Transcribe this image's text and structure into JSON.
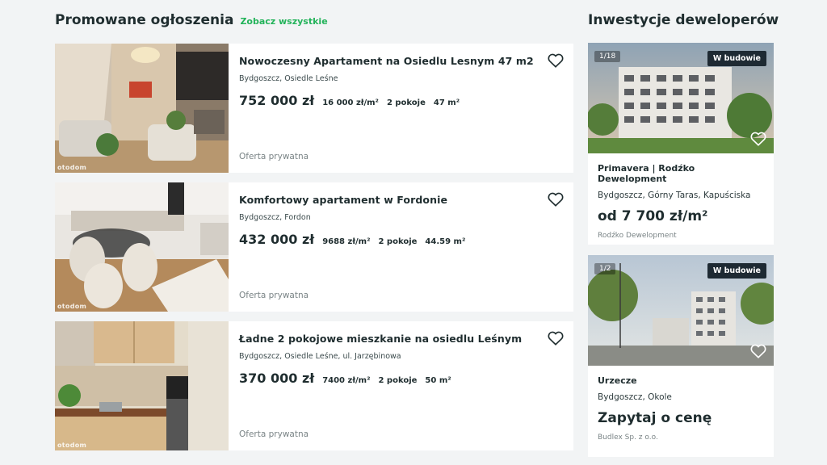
{
  "promoted": {
    "title": "Promowane ogłoszenia",
    "see_all": "Zobacz wszystkie",
    "listings": [
      {
        "title": "Nowoczesny Apartament na Osiedlu Lesnym 47 m2",
        "location": "Bydgoszcz, Osiedle Leśne",
        "price": "752 000 zł",
        "price_per_m2": "16 000 zł/m²",
        "rooms": "2 pokoje",
        "area": "47 m²",
        "owner": "Oferta prywatna",
        "watermark": "otodom"
      },
      {
        "title": "Komfortowy apartament w Fordonie",
        "location": "Bydgoszcz, Fordon",
        "price": "432 000 zł",
        "price_per_m2": "9688 zł/m²",
        "rooms": "2 pokoje",
        "area": "44.59 m²",
        "owner": "Oferta prywatna",
        "watermark": "otodom"
      },
      {
        "title": "Ładne 2 pokojowe mieszkanie na osiedlu Leśnym",
        "location": "Bydgoszcz, Osiedle Leśne, ul. Jarzębinowa",
        "price": "370 000 zł",
        "price_per_m2": "7400 zł/m²",
        "rooms": "2 pokoje",
        "area": "50 m²",
        "owner": "Oferta prywatna",
        "watermark": "otodom"
      }
    ]
  },
  "developer": {
    "title": "Inwestycje deweloperów",
    "cards": [
      {
        "counter": "1/18",
        "badge": "W budowie",
        "name": "Primavera | Rodźko Dewelopment",
        "location": "Bydgoszcz, Górny Taras, Kapuściska",
        "price": "od 7 700 zł/m²",
        "developer": "Rodźko Dewelopment"
      },
      {
        "counter": "1/2",
        "badge": "W budowie",
        "name": "Urzecze",
        "location": "Bydgoszcz, Okole",
        "price": "Zapytaj o cenę",
        "developer": "Budlex Sp. z o.o."
      }
    ]
  },
  "icons": {
    "heart": "heart-outline-icon"
  },
  "colors": {
    "accent": "#23b35a",
    "badge": "#1e2a33",
    "text": "#1f2d2f"
  }
}
